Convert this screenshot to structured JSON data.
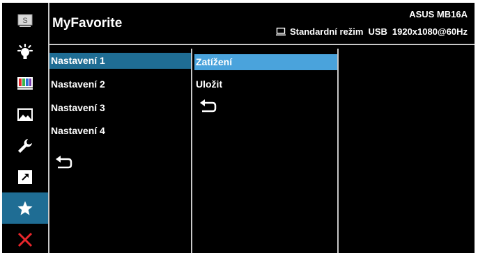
{
  "header": {
    "title": "MyFavorite",
    "model": "ASUS MB16A",
    "mode": "Standardní režim",
    "input": "USB",
    "resolution": "1920x1080@60Hz"
  },
  "sidebar": {
    "items": [
      {
        "icon": "splendid-icon"
      },
      {
        "icon": "brightness-icon"
      },
      {
        "icon": "color-icon"
      },
      {
        "icon": "image-icon"
      },
      {
        "icon": "system-setup-icon"
      },
      {
        "icon": "shortcut-icon"
      },
      {
        "icon": "star-icon",
        "active": true
      },
      {
        "icon": "close-icon"
      }
    ],
    "close_color": "#e8262b",
    "active_color": "#1f6d94"
  },
  "settings_menu": {
    "items": [
      "Nastavení 1",
      "Nastavení 2",
      "Nastavení 3",
      "Nastavení 4"
    ],
    "selected_index": 0,
    "back_icon": "back-icon"
  },
  "submenu": {
    "items": [
      "Zatížení",
      "Uložit"
    ],
    "selected_index": 0,
    "back_icon": "back-icon",
    "selected_color": "#4aa3dc"
  }
}
